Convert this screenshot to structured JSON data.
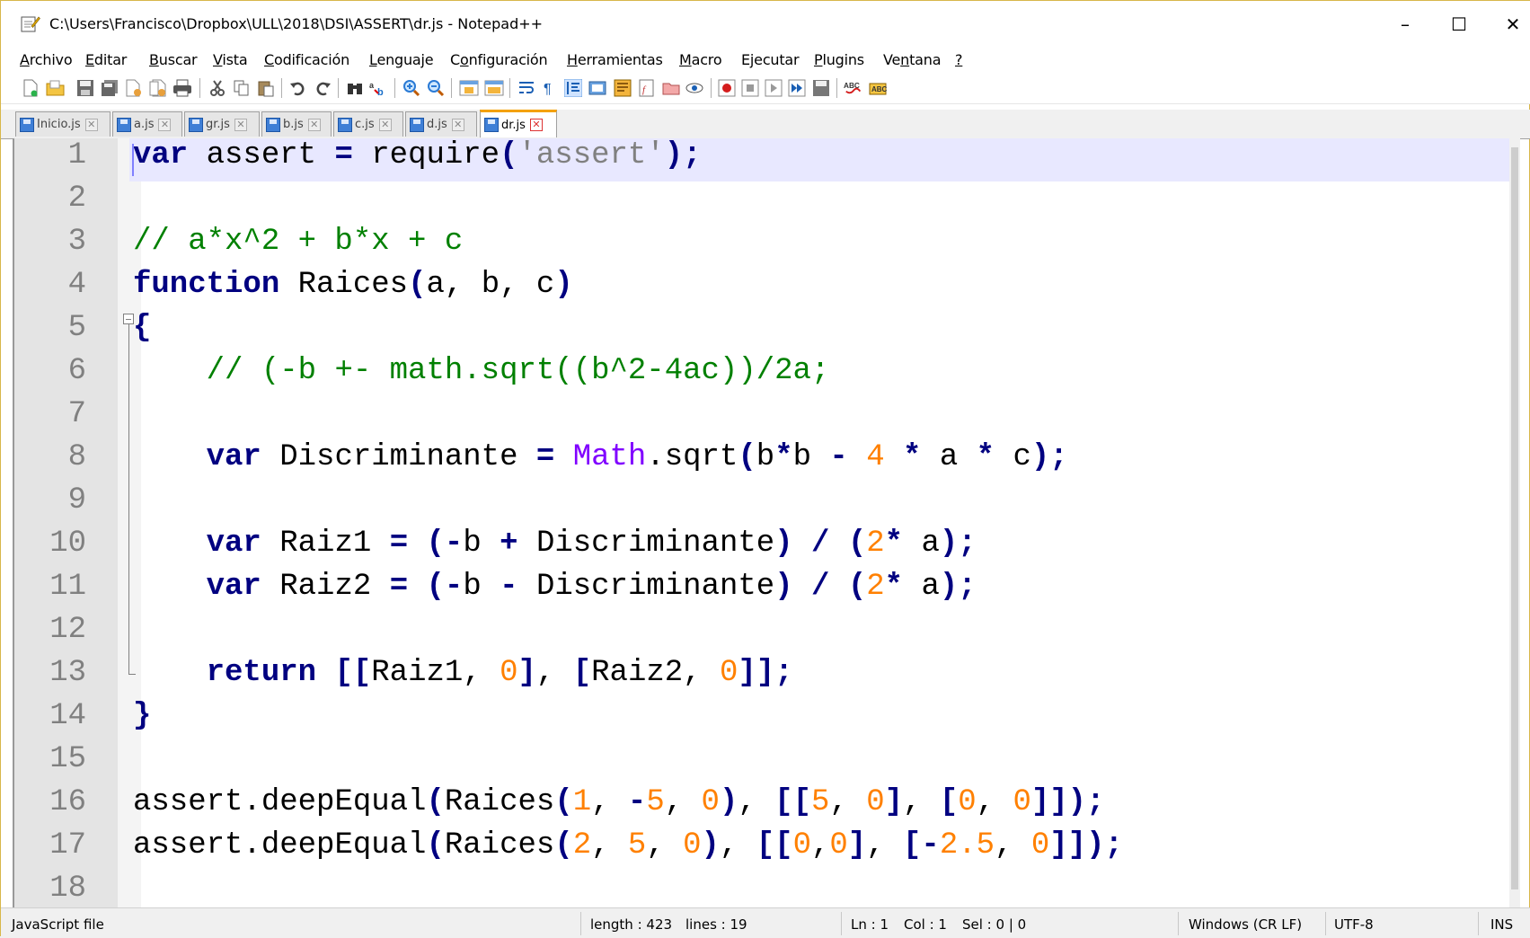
{
  "window": {
    "title": "C:\\Users\\Francisco\\Dropbox\\ULL\\2018\\DSI\\ASSERT\\dr.js - Notepad++",
    "minimize_label": "–",
    "maximize_label": "☐",
    "close_label": "✕"
  },
  "menu": [
    {
      "pre": "",
      "ul": "A",
      "post": "rchivo"
    },
    {
      "pre": "",
      "ul": "E",
      "post": "ditar"
    },
    {
      "pre": "",
      "ul": "B",
      "post": "uscar"
    },
    {
      "pre": "",
      "ul": "V",
      "post": "ista"
    },
    {
      "pre": "",
      "ul": "C",
      "post": "odificación"
    },
    {
      "pre": "",
      "ul": "L",
      "post": "enguaje"
    },
    {
      "pre": "C",
      "ul": "o",
      "post": "nfiguración"
    },
    {
      "pre": "",
      "ul": "H",
      "post": "erramientas"
    },
    {
      "pre": "",
      "ul": "M",
      "post": "acro"
    },
    {
      "pre": "E",
      "ul": "j",
      "post": "ecutar"
    },
    {
      "pre": "",
      "ul": "P",
      "post": "lugins"
    },
    {
      "pre": "Ve",
      "ul": "n",
      "post": "tana"
    },
    {
      "pre": "",
      "ul": "?",
      "post": ""
    }
  ],
  "tabs": [
    {
      "label": "Inicio.js",
      "active": false
    },
    {
      "label": "a.js",
      "active": false
    },
    {
      "label": "gr.js",
      "active": false
    },
    {
      "label": "b.js",
      "active": false
    },
    {
      "label": "c.js",
      "active": false
    },
    {
      "label": "d.js",
      "active": false
    },
    {
      "label": "dr.js",
      "active": true
    }
  ],
  "editor": {
    "line_numbers": [
      "1",
      "2",
      "3",
      "4",
      "5",
      "6",
      "7",
      "8",
      "9",
      "10",
      "11",
      "12",
      "13",
      "14",
      "15",
      "16",
      "17",
      "18"
    ],
    "code_lines": [
      "var assert = require('assert');",
      "",
      "// a*x^2 + b*x + c",
      "function Raices(a, b, c)",
      "{",
      "    // (-b +- math.sqrt((b^2-4ac))/2a;",
      "",
      "    var Discriminante = Math.sqrt(b*b - 4 * a * c);",
      "",
      "    var Raiz1 = (-b + Discriminante) / (2* a);",
      "    var Raiz2 = (-b - Discriminante) / (2* a);",
      "",
      "    return [[Raiz1, 0], [Raiz2, 0]];",
      "}",
      "",
      "assert.deepEqual(Raices(1, -5, 0), [[5, 0], [0, 0]]);",
      "assert.deepEqual(Raices(2, 5, 0), [[0,0], [-2.5, 0]]);",
      ""
    ]
  },
  "status": {
    "file_type": "JavaScript file",
    "length": "length : 423",
    "lines": "lines : 19",
    "ln": "Ln : 1",
    "col": "Col : 1",
    "sel": "Sel : 0 | 0",
    "eol": "Windows (CR LF)",
    "encoding": "UTF-8",
    "mode": "INS"
  }
}
